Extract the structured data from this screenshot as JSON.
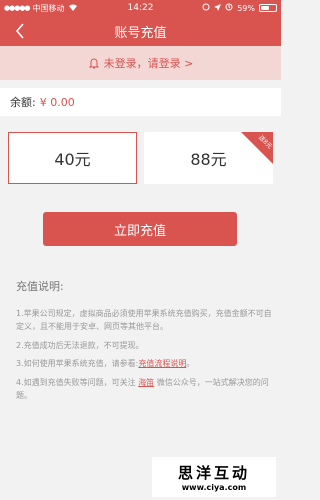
{
  "status_bar": {
    "carrier": "中国移动",
    "time": "14:22",
    "battery": "59%",
    "battery_fraction": 0.59
  },
  "nav": {
    "title": "账号充值"
  },
  "login_notice": {
    "text": "未登录，请登录 >"
  },
  "balance": {
    "label": "余额:",
    "value": "¥ 0.00"
  },
  "amounts": [
    {
      "label": "40元",
      "selected": true,
      "badge": ""
    },
    {
      "label": "88元",
      "selected": false,
      "badge": "送8元"
    }
  ],
  "recharge_button": {
    "label": "立即充值"
  },
  "info": {
    "title": "充值说明:",
    "items": [
      {
        "text": "1.苹果公司规定，虚拟商品必须使用苹果系统充值购买，充值金额不可自定义，且不能用于安卓、网页等其他平台。"
      },
      {
        "text": "2.充值成功后无法退款，不可提现。"
      },
      {
        "prefix": "3.如何使用苹果系统充值，请参看:",
        "link": "充值流程说明",
        "suffix": "。"
      },
      {
        "prefix": "4.如遇到充值失败等问题，可关注",
        "link": "海笛",
        "suffix": "微信公众号，一站式解决您的问题。"
      }
    ]
  },
  "watermark": {
    "name": "思洋互动",
    "url": "www.ciya.com"
  },
  "colors": {
    "primary": "#d9534f",
    "login_bg": "#f2d7d5",
    "page_bg": "#f2f2f2"
  }
}
